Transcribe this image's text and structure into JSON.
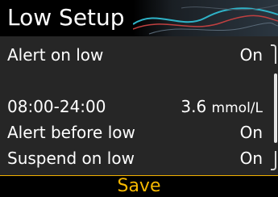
{
  "header": {
    "title": "Low Setup"
  },
  "rows": {
    "alert_on_low": {
      "label": "Alert on low",
      "value": "On"
    },
    "time_range": {
      "label": "08:00-24:00",
      "value_number": "3.6",
      "value_unit": "mmol/L"
    },
    "alert_before_low": {
      "label": "Alert before low",
      "value": "On"
    },
    "suspend_on_low": {
      "label": "Suspend on low",
      "value": "On"
    }
  },
  "footer": {
    "save_label": "Save"
  },
  "colors": {
    "accent": "#f5b800",
    "background": "#262626",
    "header_bg": "#000000",
    "text": "#ffffff"
  },
  "icons": {
    "header_decoration": "sensor-waves-icon",
    "scrollbar": "scrollbar-icon"
  }
}
